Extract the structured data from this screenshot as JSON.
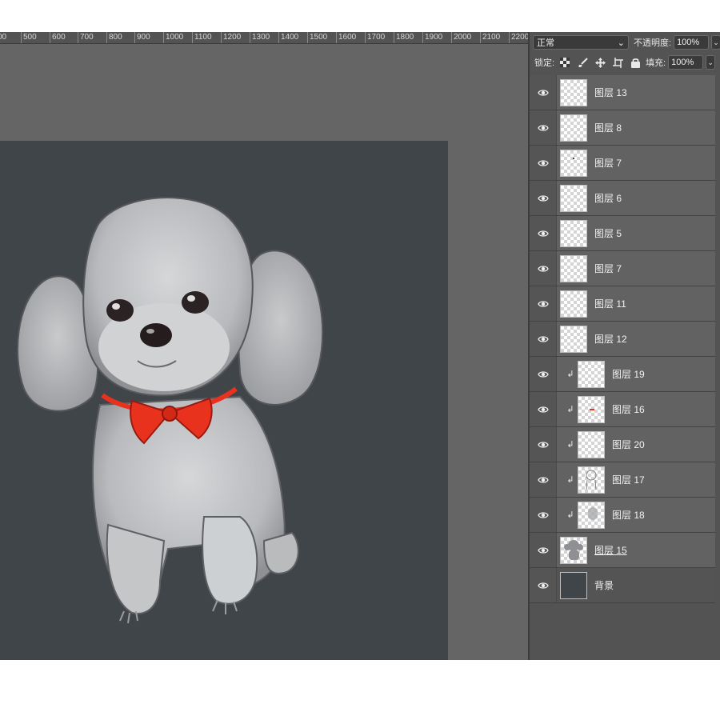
{
  "ruler": {
    "ticks": [
      "00",
      "500",
      "600",
      "700",
      "800",
      "900",
      "1000",
      "1100",
      "1200",
      "1300",
      "1400",
      "1500",
      "1600",
      "1700",
      "1800",
      "1900",
      "2000",
      "2100",
      "2200"
    ]
  },
  "layers_panel": {
    "blend_mode": "正常",
    "opacity_label": "不透明度:",
    "opacity_value": "100%",
    "lock_label": "锁定:",
    "fill_label": "填充:",
    "fill_value": "100%",
    "layers": [
      {
        "name": "图层 13",
        "clipped": false,
        "thumb": "transparent"
      },
      {
        "name": "图层 8",
        "clipped": false,
        "thumb": "transparent"
      },
      {
        "name": "图层 7",
        "clipped": false,
        "thumb": "transparent-dot"
      },
      {
        "name": "图层 6",
        "clipped": false,
        "thumb": "transparent"
      },
      {
        "name": "图层 5",
        "clipped": false,
        "thumb": "transparent"
      },
      {
        "name": "图层 7",
        "clipped": false,
        "thumb": "transparent"
      },
      {
        "name": "图层 11",
        "clipped": false,
        "thumb": "transparent"
      },
      {
        "name": "图层 12",
        "clipped": false,
        "thumb": "transparent"
      },
      {
        "name": "图层 19",
        "clipped": true,
        "thumb": "transparent"
      },
      {
        "name": "图层 16",
        "clipped": true,
        "thumb": "red-mark"
      },
      {
        "name": "图层 20",
        "clipped": true,
        "thumb": "transparent"
      },
      {
        "name": "图层 17",
        "clipped": true,
        "thumb": "sketch"
      },
      {
        "name": "图层 18",
        "clipped": true,
        "thumb": "gray-shade"
      },
      {
        "name": "图层 15",
        "clipped": false,
        "thumb": "dog-silhouette",
        "underlined": true
      },
      {
        "name": "背景",
        "clipped": false,
        "thumb": "dark-fill"
      }
    ]
  },
  "colors": {
    "canvas_bg": "#40454a",
    "workspace": "#656565",
    "bow": "#e8321e",
    "fur": "#c9cbcd"
  }
}
